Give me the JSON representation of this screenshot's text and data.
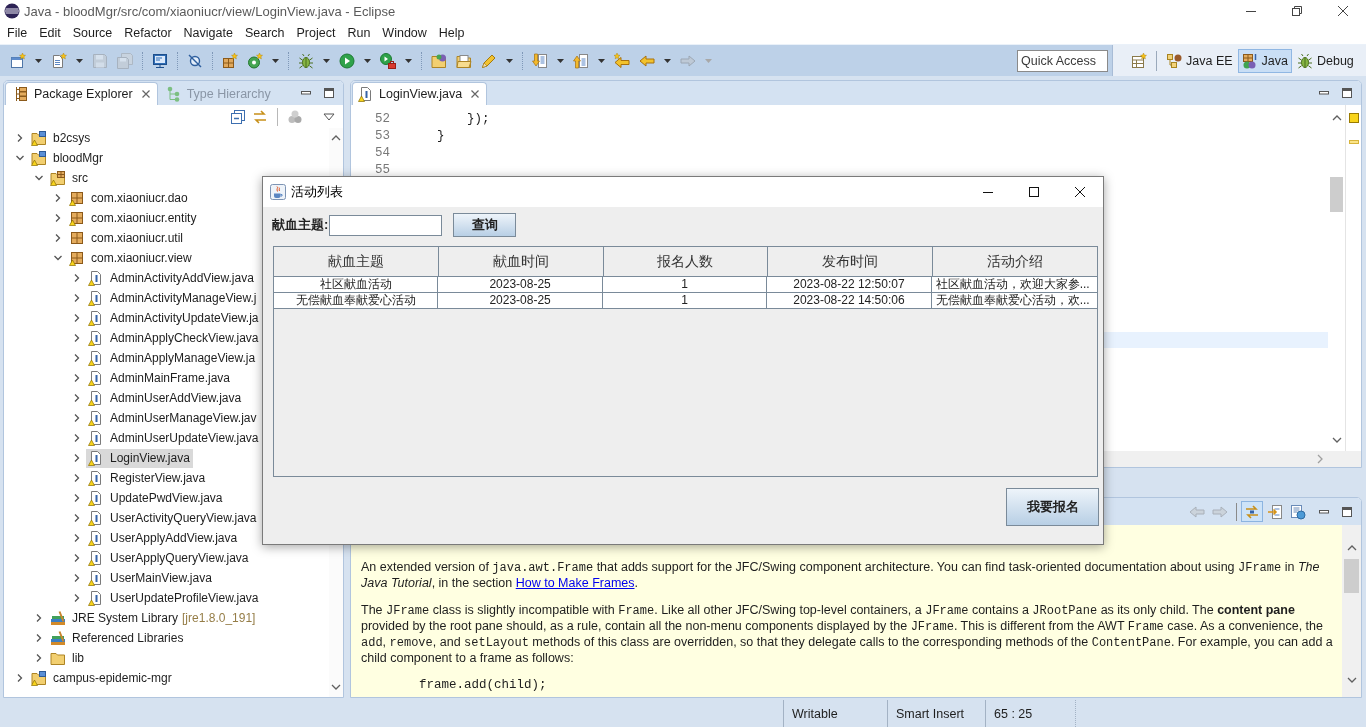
{
  "window": {
    "title": "Java - bloodMgr/src/com/xiaoniucr/view/LoginView.java - Eclipse"
  },
  "menu": [
    "File",
    "Edit",
    "Source",
    "Refactor",
    "Navigate",
    "Search",
    "Project",
    "Run",
    "Window",
    "Help"
  ],
  "toolbar": [
    {
      "kind": "new",
      "dropdown": true,
      "disabled": false
    },
    {
      "kind": "new-file",
      "dropdown": true,
      "disabled": false
    },
    {
      "kind": "save",
      "dropdown": false,
      "disabled": true
    },
    {
      "kind": "save-all",
      "dropdown": false,
      "disabled": true
    },
    {
      "kind": "separator"
    },
    {
      "kind": "console",
      "dropdown": false,
      "disabled": false
    },
    {
      "kind": "separator"
    },
    {
      "kind": "skip-breakpoints",
      "dropdown": false,
      "disabled": false
    },
    {
      "kind": "separator"
    },
    {
      "kind": "new-package",
      "dropdown": false,
      "disabled": false
    },
    {
      "kind": "new-class",
      "dropdown": true,
      "disabled": false
    },
    {
      "kind": "separator"
    },
    {
      "kind": "debug",
      "dropdown": true,
      "disabled": false
    },
    {
      "kind": "run",
      "dropdown": true,
      "disabled": false
    },
    {
      "kind": "run-external",
      "dropdown": true,
      "disabled": false
    },
    {
      "kind": "separator"
    },
    {
      "kind": "open-type",
      "dropdown": false,
      "disabled": false
    },
    {
      "kind": "open-task",
      "dropdown": false,
      "disabled": false
    },
    {
      "kind": "search",
      "dropdown": true,
      "disabled": false
    },
    {
      "kind": "separator"
    },
    {
      "kind": "next-annotation",
      "dropdown": true,
      "disabled": false
    },
    {
      "kind": "prev-annotation",
      "dropdown": true,
      "disabled": false
    },
    {
      "kind": "last-edit",
      "dropdown": false,
      "disabled": false
    },
    {
      "kind": "back",
      "dropdown": true,
      "disabled": false
    },
    {
      "kind": "forward",
      "dropdown": true,
      "disabled": true
    }
  ],
  "quick_access": {
    "placeholder": "Quick Access"
  },
  "perspectives": [
    {
      "kind": "java-ee",
      "label": "Java EE",
      "selected": false
    },
    {
      "kind": "java",
      "label": "Java",
      "selected": true
    },
    {
      "kind": "debug",
      "label": "Debug",
      "selected": false
    }
  ],
  "package_explorer": {
    "tabs": [
      {
        "kind": "packages",
        "label": "Package Explorer",
        "selected": true
      },
      {
        "kind": "hierarchy",
        "label": "Type Hierarchy",
        "selected": false
      }
    ],
    "tree": [
      {
        "kind": "project",
        "label": "b2csys",
        "warning": true,
        "expanded": false,
        "selected": false
      },
      {
        "kind": "project",
        "label": "bloodMgr",
        "warning": true,
        "expanded": true,
        "selected": false,
        "children": [
          {
            "kind": "source-folder",
            "label": "src",
            "warning": true,
            "expanded": true,
            "selected": false,
            "children": [
              {
                "kind": "package",
                "label": "com.xiaoniucr.dao",
                "warning": true,
                "expanded": false,
                "selected": false
              },
              {
                "kind": "package",
                "label": "com.xiaoniucr.entity",
                "warning": true,
                "expanded": false,
                "selected": false
              },
              {
                "kind": "package",
                "label": "com.xiaoniucr.util",
                "warning": false,
                "expanded": false,
                "selected": false
              },
              {
                "kind": "package",
                "label": "com.xiaoniucr.view",
                "warning": true,
                "expanded": true,
                "selected": false,
                "children": [
                  {
                    "kind": "java-file",
                    "label": "AdminActivityAddView.java",
                    "warning": true,
                    "expanded": false,
                    "selected": false
                  },
                  {
                    "kind": "java-file",
                    "label": "AdminActivityManageView.j",
                    "warning": true,
                    "expanded": false,
                    "selected": false
                  },
                  {
                    "kind": "java-file",
                    "label": "AdminActivityUpdateView.ja",
                    "warning": true,
                    "expanded": false,
                    "selected": false
                  },
                  {
                    "kind": "java-file",
                    "label": "AdminApplyCheckView.java",
                    "warning": true,
                    "expanded": false,
                    "selected": false
                  },
                  {
                    "kind": "java-file",
                    "label": "AdminApplyManageView.ja",
                    "warning": true,
                    "expanded": false,
                    "selected": false
                  },
                  {
                    "kind": "java-file",
                    "label": "AdminMainFrame.java",
                    "warning": true,
                    "expanded": false,
                    "selected": false
                  },
                  {
                    "kind": "java-file",
                    "label": "AdminUserAddView.java",
                    "warning": true,
                    "expanded": false,
                    "selected": false
                  },
                  {
                    "kind": "java-file",
                    "label": "AdminUserManageView.jav",
                    "warning": true,
                    "expanded": false,
                    "selected": false
                  },
                  {
                    "kind": "java-file",
                    "label": "AdminUserUpdateView.java",
                    "warning": true,
                    "expanded": false,
                    "selected": false
                  },
                  {
                    "kind": "java-file",
                    "label": "LoginView.java",
                    "warning": true,
                    "expanded": false,
                    "selected": true
                  },
                  {
                    "kind": "java-file",
                    "label": "RegisterView.java",
                    "warning": true,
                    "expanded": false,
                    "selected": false
                  },
                  {
                    "kind": "java-file",
                    "label": "UpdatePwdView.java",
                    "warning": true,
                    "expanded": false,
                    "selected": false
                  },
                  {
                    "kind": "java-file",
                    "label": "UserActivityQueryView.java",
                    "warning": true,
                    "expanded": false,
                    "selected": false
                  },
                  {
                    "kind": "java-file",
                    "label": "UserApplyAddView.java",
                    "warning": true,
                    "expanded": false,
                    "selected": false
                  },
                  {
                    "kind": "java-file",
                    "label": "UserApplyQueryView.java",
                    "warning": true,
                    "expanded": false,
                    "selected": false
                  },
                  {
                    "kind": "java-file",
                    "label": "UserMainView.java",
                    "warning": true,
                    "expanded": false,
                    "selected": false
                  },
                  {
                    "kind": "java-file",
                    "label": "UserUpdateProfileView.java",
                    "warning": true,
                    "expanded": false,
                    "selected": false
                  }
                ]
              }
            ]
          },
          {
            "kind": "library",
            "label": "JRE System Library",
            "decoration": "[jre1.8.0_191]",
            "warning": false,
            "expanded": false,
            "selected": false
          },
          {
            "kind": "library",
            "label": "Referenced Libraries",
            "warning": false,
            "expanded": false,
            "selected": false
          },
          {
            "kind": "folder",
            "label": "lib",
            "warning": false,
            "expanded": false,
            "selected": false
          }
        ]
      },
      {
        "kind": "project",
        "label": "campus-epidemic-mgr",
        "warning": true,
        "expanded": false,
        "selected": false
      }
    ]
  },
  "editor": {
    "tabs": [
      {
        "kind": "java-file",
        "label": "LoginView.java",
        "warning": true,
        "selected": true
      }
    ],
    "lines": [
      {
        "number": "52",
        "code": "        });"
      },
      {
        "number": "53",
        "code": "    }"
      },
      {
        "number": "54"
      },
      {
        "number": "55"
      }
    ]
  },
  "javadoc": {
    "toolbar": [
      {
        "kind": "back",
        "disabled": true,
        "selected": false
      },
      {
        "kind": "forward",
        "disabled": true,
        "selected": false
      },
      {
        "kind": "separator"
      },
      {
        "kind": "link",
        "disabled": false,
        "selected": true
      },
      {
        "kind": "open-declaration",
        "disabled": false,
        "selected": false
      },
      {
        "kind": "open-external",
        "disabled": false,
        "selected": false
      }
    ],
    "paragraphs": [
      [
        {
          "kind": "text",
          "text": "An extended version of "
        },
        {
          "kind": "code",
          "text": "java.awt.Frame"
        },
        {
          "kind": "text",
          "text": " that adds support for the JFC/Swing component architecture. You can find task-oriented documentation about using "
        },
        {
          "kind": "code",
          "text": "JFrame"
        },
        {
          "kind": "text",
          "text": " in *The Java Tutorial*, in the section "
        },
        {
          "kind": "link",
          "text": "How to Make Frames"
        },
        {
          "kind": "text",
          "text": "."
        }
      ],
      [
        {
          "kind": "text",
          "text": "The "
        },
        {
          "kind": "code",
          "text": "JFrame"
        },
        {
          "kind": "text",
          "text": " class is slightly incompatible with "
        },
        {
          "kind": "code",
          "text": "Frame"
        },
        {
          "kind": "text",
          "text": ". Like all other JFC/Swing top-level containers, a "
        },
        {
          "kind": "code",
          "text": "JFrame"
        },
        {
          "kind": "text",
          "text": " contains a "
        },
        {
          "kind": "code",
          "text": "JRootPane"
        },
        {
          "kind": "text",
          "text": " as its only child. The **content pane** provided by the root pane should, as a rule, contain all the non-menu components displayed by the "
        },
        {
          "kind": "code",
          "text": "JFrame"
        },
        {
          "kind": "text",
          "text": ". This is different from the AWT "
        },
        {
          "kind": "code",
          "text": "Frame"
        },
        {
          "kind": "text",
          "text": " case. As a convenience, the "
        },
        {
          "kind": "code",
          "text": "add"
        },
        {
          "kind": "text",
          "text": ", "
        },
        {
          "kind": "code",
          "text": "remove"
        },
        {
          "kind": "text",
          "text": ", and "
        },
        {
          "kind": "code",
          "text": "setLayout"
        },
        {
          "kind": "text",
          "text": " methods of this class are overridden, so that they delegate calls to the corresponding methods of the "
        },
        {
          "kind": "code",
          "text": "ContentPane"
        },
        {
          "kind": "text",
          "text": ". For example, you can add a child component to a frame as follows:"
        }
      ]
    ],
    "code_sample": "frame.add(child);"
  },
  "status_bar": {
    "fields": [
      "Writable",
      "Smart Insert",
      "65 : 25"
    ]
  },
  "dialog": {
    "title": "活动列表",
    "search": {
      "label": "献血主题:"
    },
    "query_button": "查询",
    "table": {
      "columns": [
        "献血主题",
        "献血时间",
        "报名人数",
        "发布时间",
        "活动介绍"
      ],
      "rows": [
        {
          "selected": false,
          "cells": [
            "社区献血活动",
            "2023-08-25",
            "1",
            "2023-08-22 12:50:07",
            "社区献血活动，欢迎大家参..."
          ]
        },
        {
          "selected": false,
          "cells": [
            "无偿献血奉献爱心活动",
            "2023-08-25",
            "1",
            "2023-08-22 14:50:06",
            "无偿献血奉献爱心活动，欢..."
          ]
        }
      ]
    },
    "signup_button": "我要报名"
  }
}
